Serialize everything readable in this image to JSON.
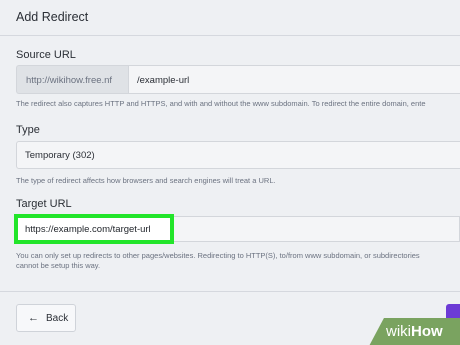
{
  "dialog": {
    "title": "Add Redirect"
  },
  "source": {
    "label": "Source URL",
    "prefix": "http://wikihow.free.nf",
    "value": "/example-url",
    "help": "The redirect also captures HTTP and HTTPS, and with and without the www subdomain. To redirect the entire domain, ente"
  },
  "type": {
    "label": "Type",
    "selected": "Temporary (302)",
    "help": "The type of redirect affects how browsers and search engines will treat a URL."
  },
  "target": {
    "label": "Target URL",
    "value": "https://example.com/target-url",
    "help_line1": "You can only set up redirects to other pages/websites. Redirecting to HTTP(S), to/from www subdomain, or subdirectories",
    "help_line2": "cannot be setup this way.",
    "highlight_color": "#22e52a"
  },
  "footer": {
    "back_label": "Back",
    "back_icon": "arrow-left-icon",
    "primary_color": "#6c3bd5"
  },
  "watermark": {
    "text_wiki": "wiki",
    "text_how": "How"
  }
}
